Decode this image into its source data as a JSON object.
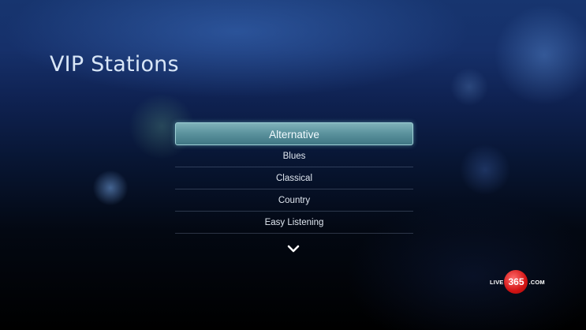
{
  "page": {
    "title": "VIP Stations"
  },
  "menu": {
    "items": [
      {
        "label": "Alternative",
        "selected": true
      },
      {
        "label": "Blues",
        "selected": false
      },
      {
        "label": "Classical",
        "selected": false
      },
      {
        "label": "Country",
        "selected": false
      },
      {
        "label": "Easy Listening",
        "selected": false
      }
    ]
  },
  "icons": {
    "scroll_down": "chevron-down-icon"
  },
  "logo": {
    "left": "LIVE",
    "number": "365",
    "right": ".COM"
  },
  "colors": {
    "selected_bg": "#5d949f",
    "title_text": "#d8e6f7",
    "logo_red": "#d21414"
  }
}
